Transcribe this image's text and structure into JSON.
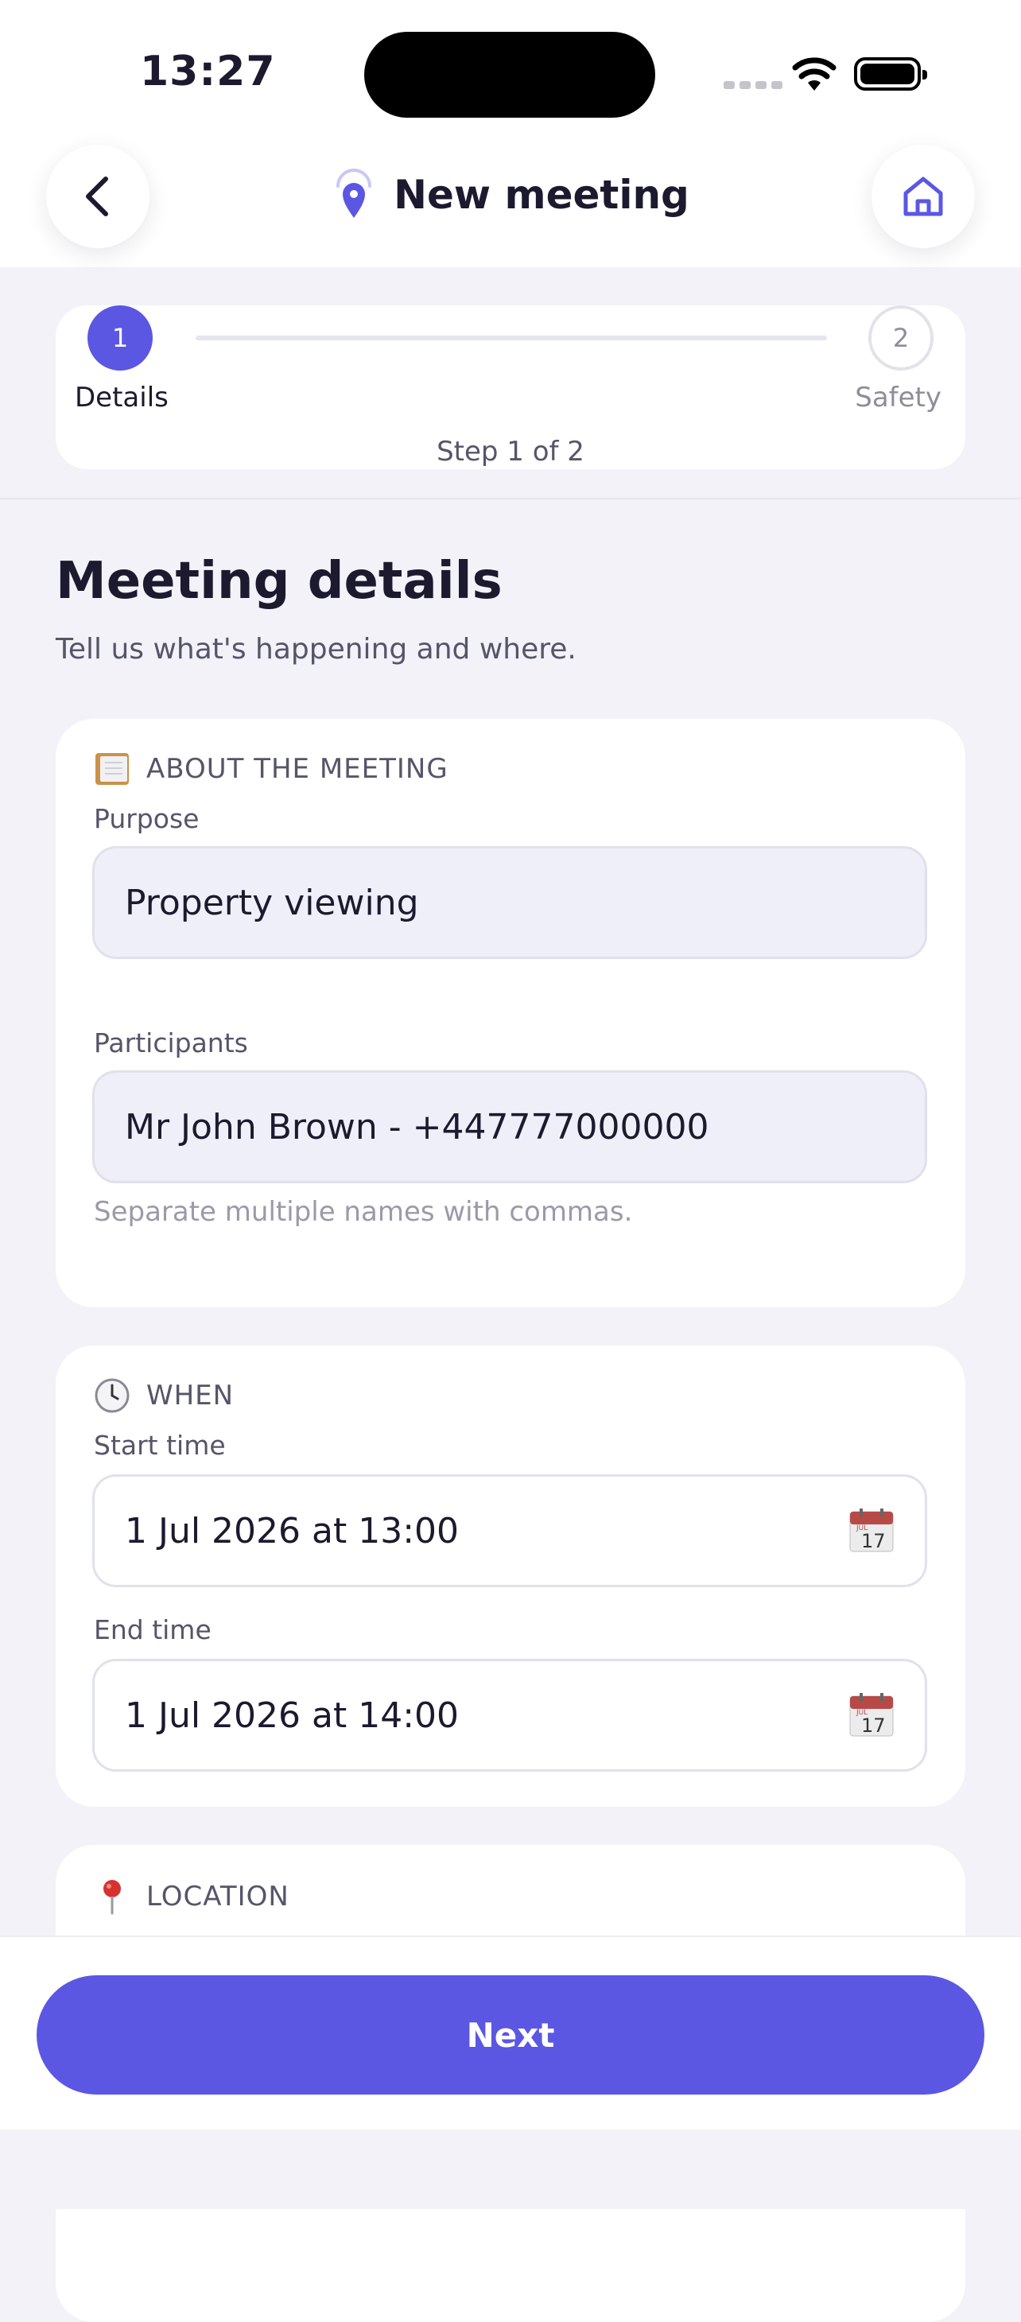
{
  "status_bar": {
    "time": "13:27"
  },
  "header": {
    "title": "New meeting",
    "back_icon": "chevron-left-icon",
    "home_icon": "home-icon",
    "title_icon": "location-pin-icon"
  },
  "stepper": {
    "steps": [
      {
        "number": "1",
        "label": "Details"
      },
      {
        "number": "2",
        "label": "Safety"
      }
    ],
    "count_text": "Step 1 of 2"
  },
  "page": {
    "title": "Meeting details",
    "subtitle": "Tell us what's happening and where."
  },
  "about": {
    "heading": "ABOUT THE MEETING",
    "purpose_label": "Purpose",
    "purpose_value": "Property viewing",
    "participants_label": "Participants",
    "participants_value": "Mr John Brown - +447777000000",
    "participants_hint": "Separate multiple names with commas."
  },
  "when": {
    "heading": "WHEN",
    "start_label": "Start time",
    "start_value": "1 Jul 2026 at 13:00",
    "end_label": "End time",
    "end_value": "1 Jul 2026 at 14:00",
    "calendar_day": "17",
    "calendar_month": "JUL"
  },
  "location": {
    "heading": "LOCATION"
  },
  "footer": {
    "next_label": "Next"
  },
  "colors": {
    "accent": "#5B57E3",
    "background": "#F2F2F8",
    "text": "#1B1A2E",
    "muted": "#55556A"
  }
}
